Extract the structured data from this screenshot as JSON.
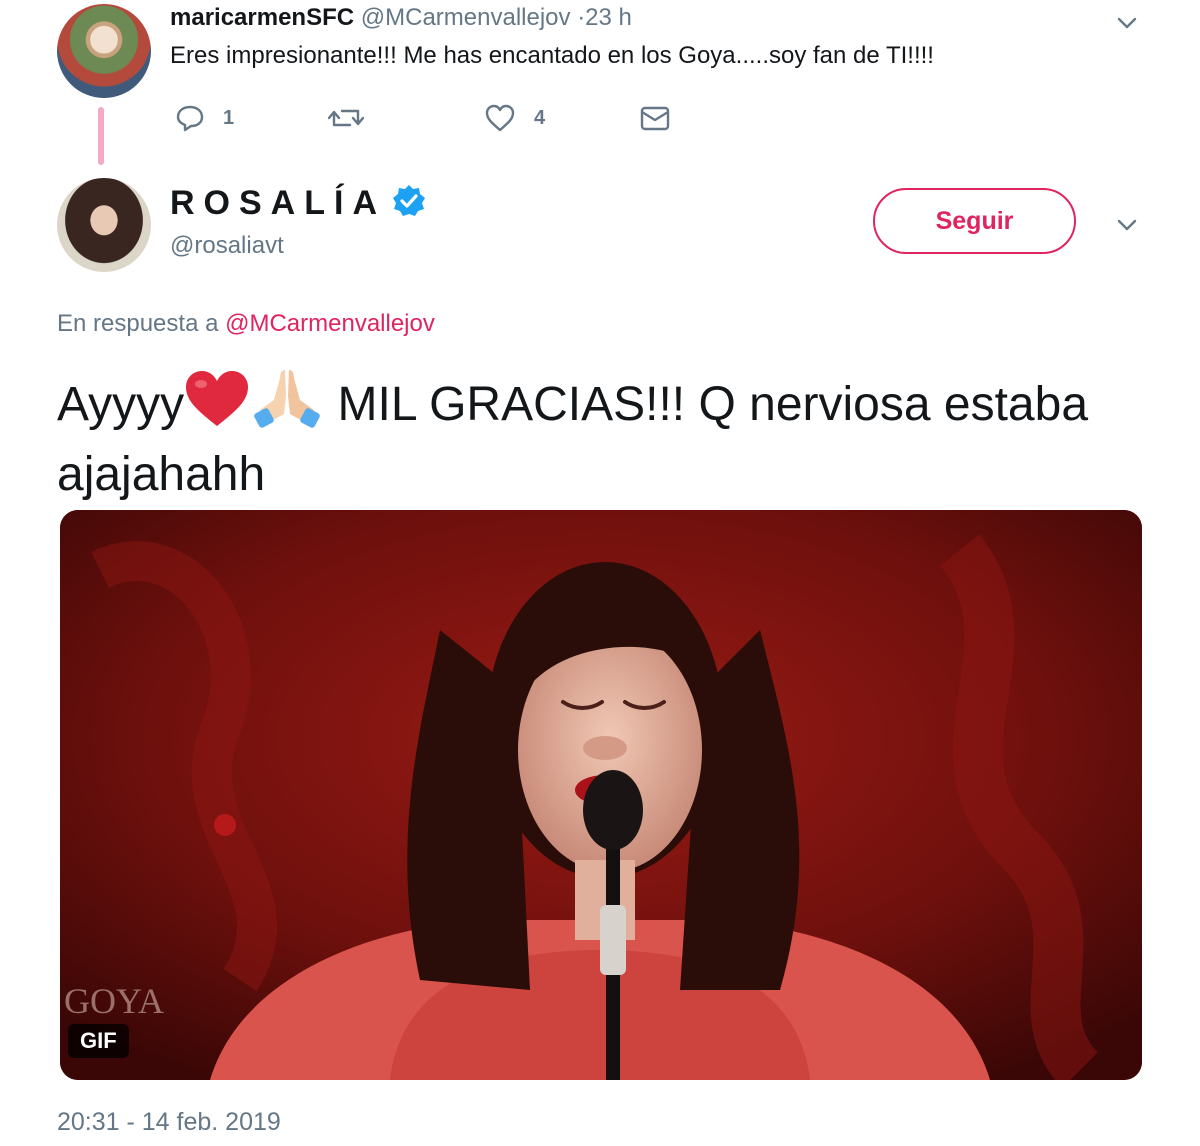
{
  "reply": {
    "name": "maricarmenSFC",
    "handle": "@MCarmenvallejov",
    "time": "·23 h",
    "text": "Eres impresionante!!! Me has encantado en los Goya.....soy  fan de TI!!!!",
    "actions": {
      "reply_count": "1",
      "retweet_count": "",
      "like_count": "4"
    },
    "icons": [
      "reply-icon",
      "retweet-icon",
      "like-icon",
      "message-icon",
      "chevron-down-icon"
    ]
  },
  "tweet": {
    "name": "ROSALÍA",
    "handle": "@rosaliavt",
    "follow_label": "Seguir",
    "in_reply_prefix": "En respuesta a",
    "in_reply_handle": "@MCarmenvallejov",
    "text_part1": "Ayyyy",
    "text_part2": " MIL GRACIAS!!! Q nerviosa estaba ajajahahh",
    "media_badge": "GIF",
    "media_watermark": "GOYA",
    "timestamp": "20:31 - 14 feb. 2019",
    "icons": [
      "verified-badge-icon",
      "red-heart-icon",
      "folded-hands-icon",
      "chevron-down-icon"
    ]
  },
  "colors": {
    "accent": "#e0245e",
    "verified": "#1da1f2",
    "muted": "#657786",
    "text": "#14171a",
    "thread_line": "#f4a9c6"
  }
}
